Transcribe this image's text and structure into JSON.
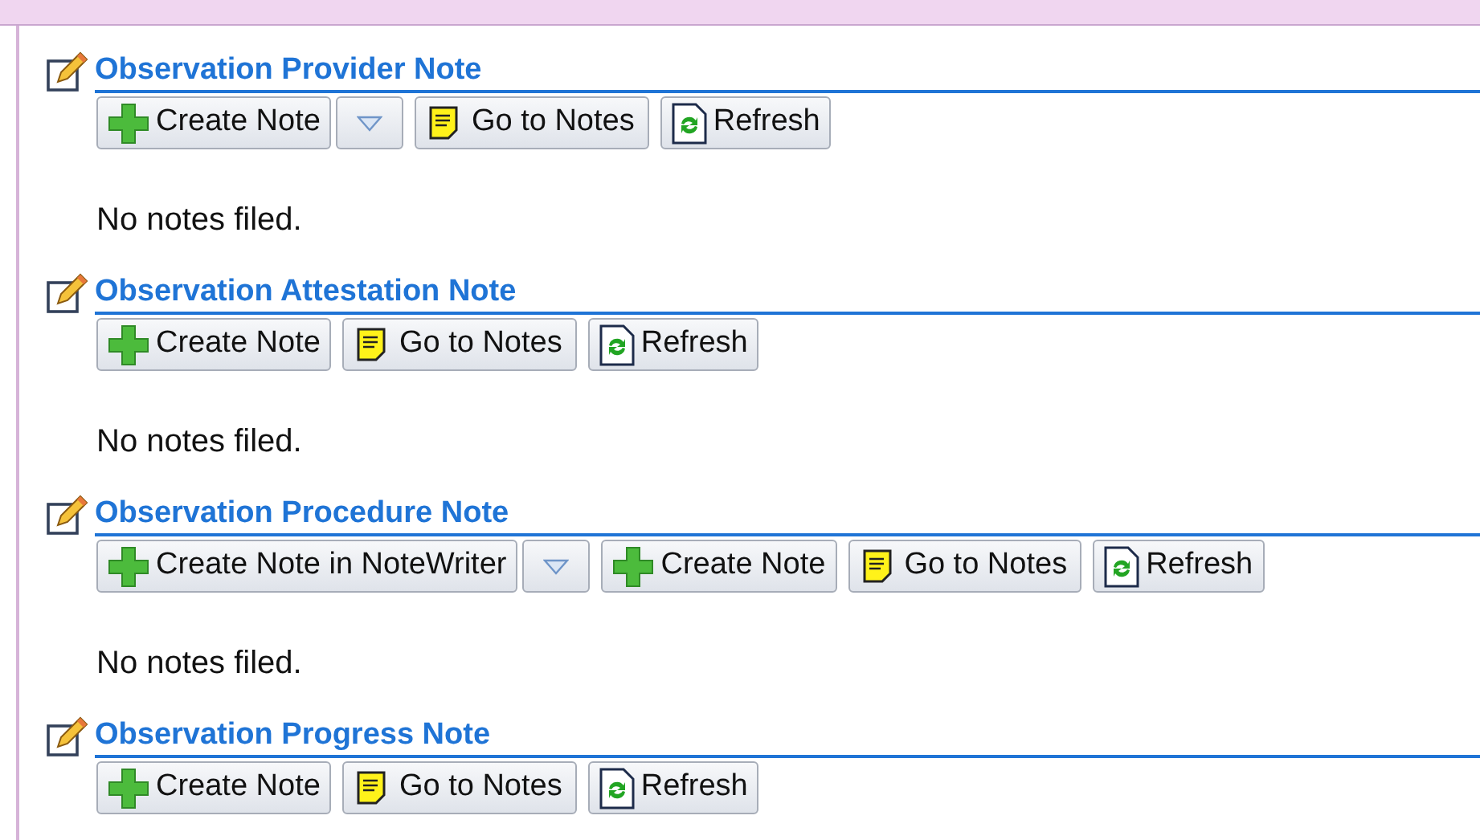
{
  "sections": [
    {
      "title": "Observation Provider Note",
      "buttons": [
        {
          "kind": "create",
          "label": "Create Note"
        },
        {
          "kind": "dropdown"
        },
        {
          "kind": "notes",
          "label": "Go to Notes"
        },
        {
          "kind": "refresh",
          "label": "Refresh"
        }
      ],
      "message": "No notes filed."
    },
    {
      "title": "Observation Attestation Note",
      "buttons": [
        {
          "kind": "create",
          "label": "Create Note"
        },
        {
          "kind": "notes",
          "label": "Go to Notes"
        },
        {
          "kind": "refresh",
          "label": "Refresh"
        }
      ],
      "message": "No notes filed."
    },
    {
      "title": "Observation Procedure Note",
      "buttons": [
        {
          "kind": "create",
          "label": "Create Note in NoteWriter"
        },
        {
          "kind": "dropdown"
        },
        {
          "kind": "create",
          "label": "Create Note"
        },
        {
          "kind": "notes",
          "label": "Go to Notes"
        },
        {
          "kind": "refresh",
          "label": "Refresh"
        }
      ],
      "message": "No notes filed."
    },
    {
      "title": "Observation Progress Note",
      "buttons": [
        {
          "kind": "create",
          "label": "Create Note"
        },
        {
          "kind": "notes",
          "label": "Go to Notes"
        },
        {
          "kind": "refresh",
          "label": "Refresh"
        }
      ]
    }
  ]
}
